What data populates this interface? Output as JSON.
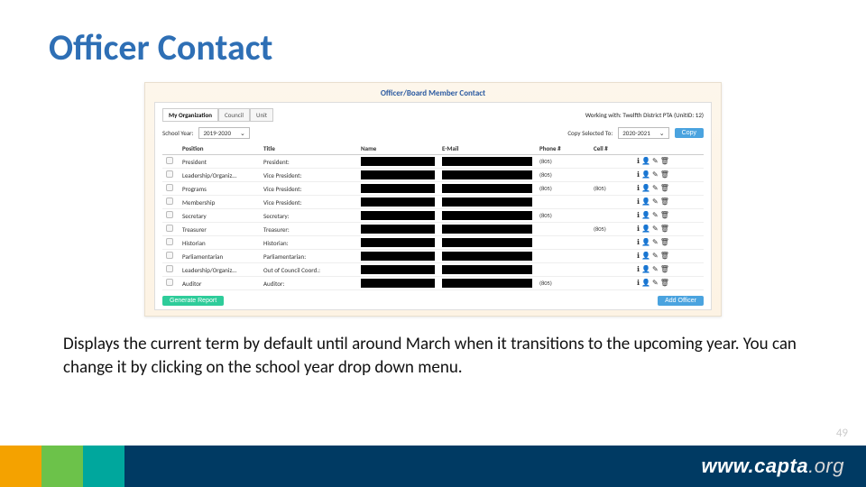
{
  "title": "Officer Contact",
  "panel": {
    "heading": "Officer/Board Member Contact"
  },
  "tabs": [
    "My Organization",
    "Council",
    "Unit"
  ],
  "working_with": "Working with: Twelfth District PTA (UnitID: 12)",
  "school_year": {
    "label": "School Year:",
    "value": "2019-2020"
  },
  "copy": {
    "label": "Copy Selected To:",
    "value": "2020-2021",
    "button": "Copy"
  },
  "columns": [
    "",
    "Position",
    "Title",
    "Name",
    "E-Mail",
    "Phone #",
    "Cell #",
    ""
  ],
  "rows": [
    {
      "position": "President",
      "title": "President:",
      "phone": "(805)"
    },
    {
      "position": "Leadership/Organiz…",
      "title": "Vice President:",
      "phone": "(805)"
    },
    {
      "position": "Programs",
      "title": "Vice President:",
      "phone": "(805)"
    },
    {
      "position": "Membership",
      "title": "Vice President:",
      "phone": ""
    },
    {
      "position": "Secretary",
      "title": "Secretary:",
      "phone": "(805)"
    },
    {
      "position": "Treasurer",
      "title": "Treasurer:",
      "phone": ""
    },
    {
      "position": "Historian",
      "title": "Historian:",
      "phone": ""
    },
    {
      "position": "Parliamentarian",
      "title": "Parliamentarian:",
      "phone": ""
    },
    {
      "position": "Leadership/Organiz…",
      "title": "Out of Council Coord.:",
      "phone": ""
    },
    {
      "position": "Auditor",
      "title": "Auditor:",
      "phone": "(805)"
    }
  ],
  "phone_extra": {
    "2": "(805)",
    "5": "(805)"
  },
  "buttons": {
    "generate": "Generate Report",
    "add": "Add Officer"
  },
  "caption": "Displays the current term by default until around March when it transitions to the upcoming year. You can change it by clicking on the school year drop down menu.",
  "footer": {
    "url_main": "www.capta",
    "url_suffix": ".org"
  },
  "page_number": "49"
}
